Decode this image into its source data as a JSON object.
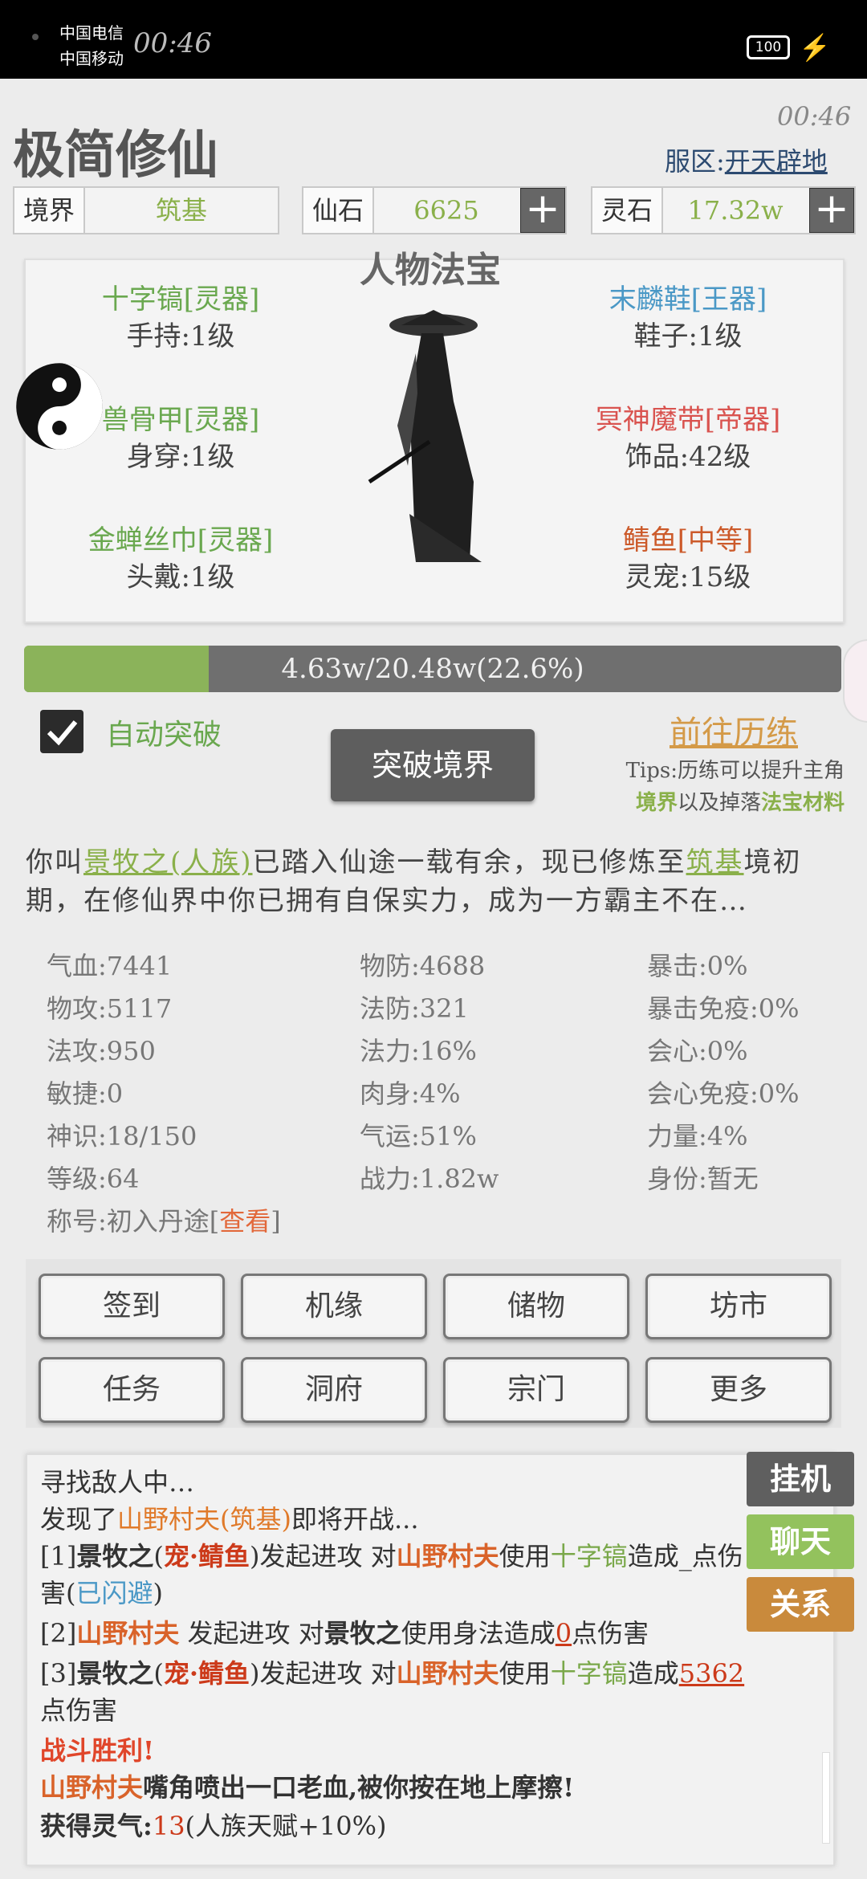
{
  "status_bar": {
    "carrier1": "中国电信",
    "carrier2": "中国移动",
    "clock": "00:46",
    "battery": "100"
  },
  "header": {
    "title": "极简修仙",
    "time": "00:46",
    "server_label": "服区:",
    "server_name": "开天辟地"
  },
  "resources": {
    "realm": {
      "label": "境界",
      "value": "筑基"
    },
    "xianshi": {
      "label": "仙石",
      "value": "6625"
    },
    "lingshi": {
      "label": "灵石",
      "value": "17.32w"
    }
  },
  "equipment": {
    "title": "人物法宝",
    "items": [
      {
        "name": "十字镐[灵器]",
        "level": "手持:1级"
      },
      {
        "name": "末麟鞋[王器]",
        "level": "鞋子:1级"
      },
      {
        "name": "兽骨甲[灵器]",
        "level": "身穿:1级"
      },
      {
        "name": "冥神魔带[帝器]",
        "level": "饰品:42级"
      },
      {
        "name": "金蝉丝巾[灵器]",
        "level": "头戴:1级"
      },
      {
        "name": "鲭鱼[中等]",
        "level": "灵宠:15级"
      }
    ]
  },
  "progress": {
    "text": "4.63w/20.48w(22.6%)",
    "fraction": 0.226
  },
  "breakthrough": {
    "auto_label": "自动突破",
    "auto_checked": true,
    "button": "突破境界",
    "go_train": "前往历练",
    "tips_line1": "Tips:历练可以提升主角",
    "tips_g1": "境界",
    "tips_mid": "以及掉落",
    "tips_g2": "法宝材料"
  },
  "description": {
    "p1": "你叫",
    "name": "景牧之(人族)",
    "p2": "已踏入仙途一载有余，现已修炼至",
    "realm": "筑基",
    "p3": "境初期，在修仙界中你已拥有自保实力，成为一方霸主不在…"
  },
  "stats": {
    "col1": [
      "气血:7441",
      "物攻:5117",
      "法攻:950",
      "敏捷:0",
      "神识:18/150",
      "等级:64"
    ],
    "col2": [
      "物防:4688",
      "法防:321",
      "法力:16%",
      "肉身:4%",
      "气运:51%",
      "战力:1.82w"
    ],
    "col3": [
      "暴击:0%",
      "暴击免疫:0%",
      "会心:0%",
      "会心免疫:0%",
      "力量:4%",
      "身份:暂无"
    ],
    "title_label": "称号:初入丹途[",
    "title_link": "查看",
    "title_end": "]"
  },
  "actions": [
    "签到",
    "机缘",
    "储物",
    "坊市",
    "任务",
    "洞府",
    "宗门",
    "更多"
  ],
  "log": {
    "l1": "寻找敌人中…",
    "l2a": "发现了",
    "l2b": "山野村夫(筑基)",
    "l2c": "即将开战...",
    "l3a": "[1]",
    "l3b": "景牧之",
    "l3c": "(",
    "l3d": "宠·鲭鱼",
    "l3e": ")发起进攻 对",
    "l3f": "山野村夫",
    "l3g": "使用",
    "l3h": "十字镐",
    "l3i": "造成_点伤",
    "l4a": "害(",
    "l4b": "已闪避",
    "l4c": ")",
    "l5a": "[2]",
    "l5b": "山野村夫",
    "l5c": " 发起进攻 对",
    "l5d": "景牧之",
    "l5e": "使用身法造成",
    "l5f": "0",
    "l5g": "点伤害",
    "l6a": "[3]",
    "l6b": "景牧之",
    "l6c": "(",
    "l6d": "宠·鲭鱼",
    "l6e": ")发起进攻 对",
    "l6f": "山野村夫",
    "l6g": "使用",
    "l6h": "十字镐",
    "l6i": "造成",
    "l6j": "5362",
    "l7": "点伤害",
    "l8": "战斗胜利!",
    "l9a": "山野村夫",
    "l9b": "嘴角喷出一口老血,被你按在地上摩擦!",
    "l10a": "获得灵气:",
    "l10b": "13",
    "l10c": "(人族天赋+10%)"
  },
  "side_buttons": {
    "idle": "挂机",
    "chat": "聊天",
    "relation": "关系"
  },
  "colors": {
    "green": "#6aa84f",
    "progress_fill": "#8bb35a",
    "chat_btn": "#93c25d",
    "relation_btn": "#c98a3c",
    "idle_btn": "#5f5f5f"
  }
}
